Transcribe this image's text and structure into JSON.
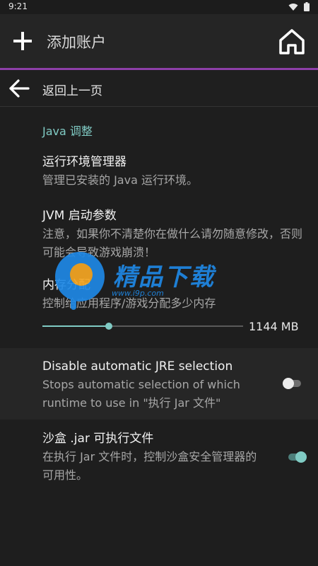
{
  "status_bar": {
    "time": "9:21",
    "icons": [
      "wifi-icon",
      "battery-icon"
    ]
  },
  "app_bar": {
    "title": "添加账户",
    "add_icon": "plus-icon",
    "home_icon": "home-icon"
  },
  "back_row": {
    "label": "返回上一页",
    "icon": "arrow-left-icon"
  },
  "section": {
    "title": "Java 调整"
  },
  "prefs": [
    {
      "title": "运行环境管理器",
      "summary": "管理已安装的 Java 运行环境。"
    },
    {
      "title": "JVM 启动参数",
      "summary": "注意，如果你不清楚你在做什么请勿随意修改，否则可能会导致游戏崩溃！"
    },
    {
      "title": "内存分配",
      "summary": "控制给应用程序/游戏分配多少内存"
    },
    {
      "title": "Disable automatic JRE selection",
      "summary": "Stops automatic selection of which runtime to use in \"执行 Jar 文件\"",
      "enabled": false
    },
    {
      "title": "沙盒 .jar 可执行文件",
      "summary": "在执行 Jar 文件时，控制沙盒安全管理器的可用性。",
      "enabled": true
    }
  ],
  "memory": {
    "value_label": "1144 MB",
    "fraction": 0.33
  },
  "watermark": {
    "name": "精品下载",
    "url": "www.i9p.com"
  },
  "colors": {
    "accent": "#80cbc4",
    "divider": "#8d3fa8",
    "background": "#1e1e1e"
  }
}
